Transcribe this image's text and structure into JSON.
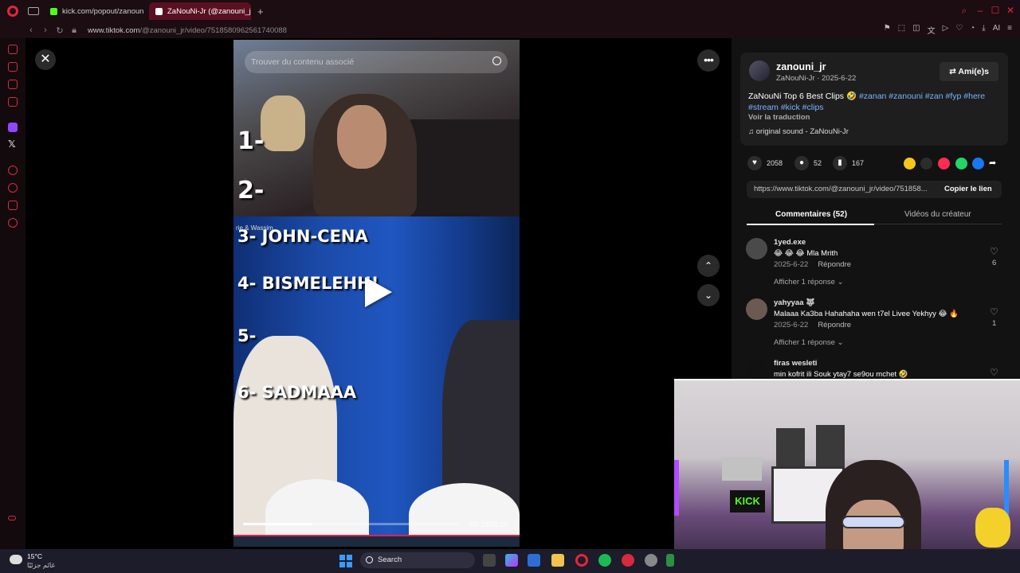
{
  "browser": {
    "tabs": [
      {
        "label": "kick.com/popout/zanouni"
      },
      {
        "label": "ZaNouNi-Jr (@zanouni_jr)"
      }
    ],
    "url_domain": "www.tiktok.com",
    "url_path": "/@zanouni_jr/video/7518580962561740088"
  },
  "video": {
    "search_placeholder": "Trouver du contenu associé",
    "overlay_caption": "rie & Wassim",
    "ranks": [
      "1-",
      "2-",
      "3- JOHN-CENA",
      "4- BISMELEHH!",
      "5-",
      "6- SADMAAA"
    ],
    "progress": 0.32,
    "time": "00:23/01:10"
  },
  "post": {
    "username": "zanouni_jr",
    "handle_date": "ZaNouNi-Jr · 2025-6-22",
    "friends_label": "Ami(e)s",
    "desc_text": "ZaNouNi Top 6 Best Clips 🤣 ",
    "tags": "#zanan #zanouni #zan #fyp #here #stream #kick #clips",
    "translate": "Voir la traduction",
    "sound": "original sound - ZaNouNi-Jr",
    "likes": "2058",
    "comments": "52",
    "saves": "167",
    "link": "https://www.tiktok.com/@zanouni_jr/video/751858...",
    "copy_label": "Copier le lien",
    "tab_comments": "Commentaires (52)",
    "tab_videos": "Vidéos du créateur"
  },
  "comments": [
    {
      "name": "1yed.exe",
      "text": "😂 😂 😂 Mla Mrith",
      "date": "2025-6-22",
      "reply": "Répondre",
      "likes": "6",
      "show_replies": "Afficher 1 réponse ⌄"
    },
    {
      "name": "yahyyaa 🐺",
      "text": "Malaaa Ka3ba Hahahaha wen t7el Livee Yekhyy 😂 🔥",
      "date": "2025-6-22",
      "reply": "Répondre",
      "likes": "1",
      "show_replies": "Afficher 1 réponse ⌄"
    },
    {
      "name": "firas wesleti",
      "text": "min kofrit ili Souk ytay7 se9ou mchet 🤣"
    }
  ],
  "taskbar": {
    "temp": "15°C",
    "weather": "غائم جزئيًا",
    "search": "Search"
  },
  "webcam": {
    "sign": "KICK"
  },
  "colors": {
    "accent": "#e4253c",
    "hashtag": "#7ab4ff",
    "tab_active": "#5a1021"
  }
}
